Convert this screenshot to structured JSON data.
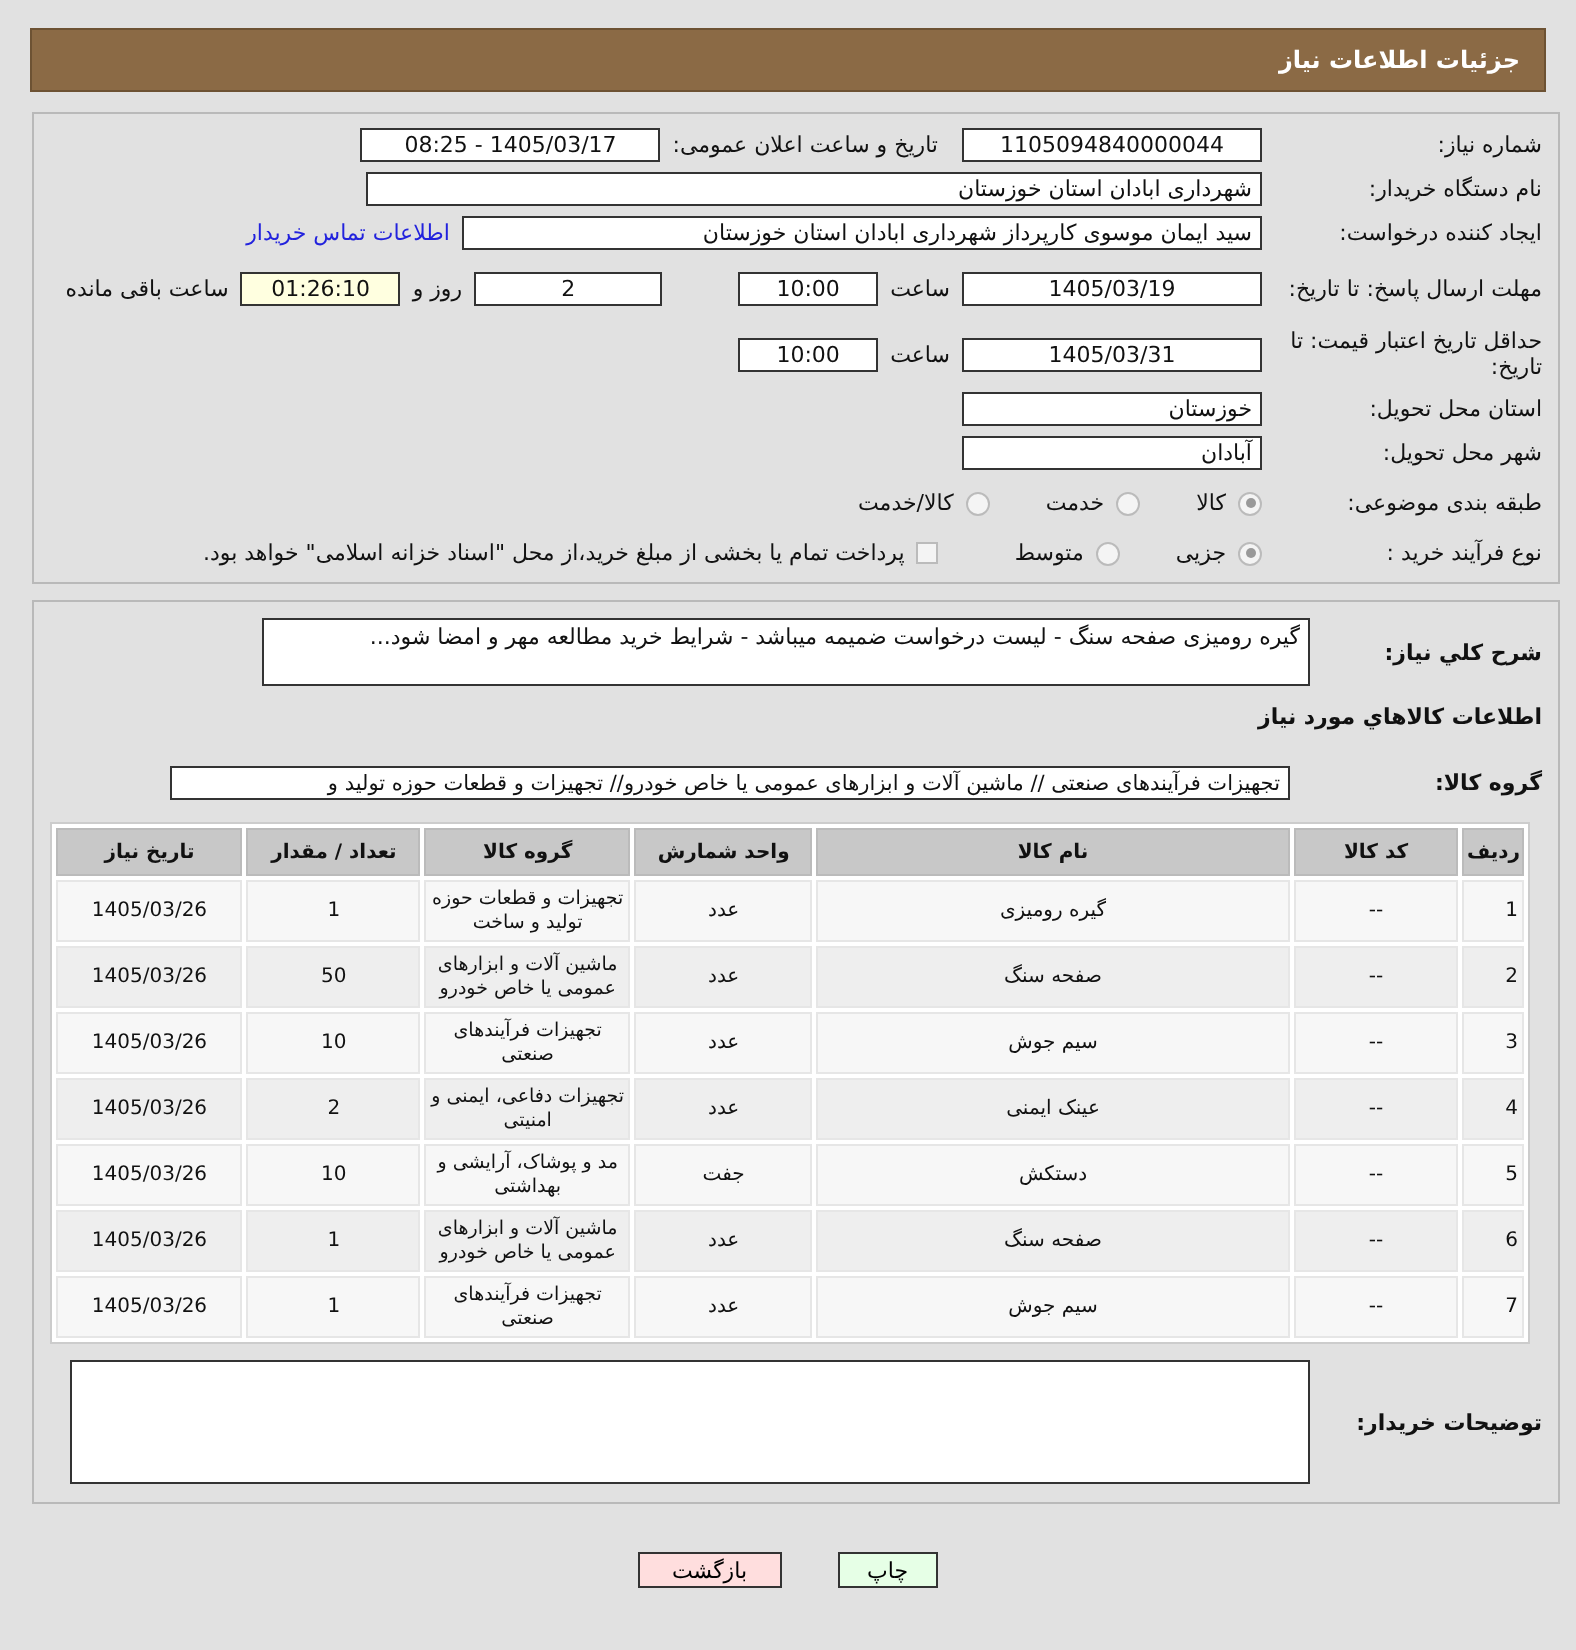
{
  "header": {
    "title": "جزئیات اطلاعات نیاز"
  },
  "details": {
    "need_number": {
      "label": "شماره نیاز:",
      "value": "1105094840000044"
    },
    "announce": {
      "label": "تاریخ و ساعت اعلان عمومی:",
      "value": "1405/03/17 - 08:25"
    },
    "buyer": {
      "label": "نام دستگاه خریدار:",
      "value": "شهرداری ابادان استان خوزستان"
    },
    "requester": {
      "label": "ایجاد کننده درخواست:",
      "value": "سید ایمان موسوی کارپرداز شهرداری ابادان استان خوزستان",
      "link": "اطلاعات تماس خریدار"
    },
    "reply_deadline": {
      "label": "مهلت ارسال پاسخ: تا تاریخ:",
      "date": "1405/03/19",
      "time_label": "ساعت",
      "time": "10:00",
      "days": "2",
      "days_label": "روز و",
      "remaining": "01:26:10",
      "remaining_label": "ساعت باقی مانده"
    },
    "price_validity": {
      "label": "حداقل تاریخ اعتبار قیمت: تا تاریخ:",
      "date": "1405/03/31",
      "time_label": "ساعت",
      "time": "10:00"
    },
    "province": {
      "label": "استان محل تحویل:",
      "value": "خوزستان"
    },
    "city": {
      "label": "شهر محل تحویل:",
      "value": "آبادان"
    },
    "category": {
      "label": "طبقه بندی موضوعی:",
      "options": [
        {
          "label": "کالا",
          "selected": true
        },
        {
          "label": "خدمت",
          "selected": false
        },
        {
          "label": "کالا/خدمت",
          "selected": false
        }
      ]
    },
    "process": {
      "label": "نوع فرآیند خرید :",
      "options": [
        {
          "label": "جزیی",
          "selected": true
        },
        {
          "label": "متوسط",
          "selected": false
        }
      ],
      "treasury": {
        "label": "پرداخت تمام یا بخشی از مبلغ خرید،از محل \"اسناد خزانه اسلامی\" خواهد بود.",
        "checked": false
      }
    }
  },
  "items": {
    "description": {
      "label": "شرح کلي نياز:",
      "value": "گیره رومیزی صفحه سنگ - لیست درخواست ضمیمه میباشد - شرایط خرید مطالعه مهر و امضا شود..."
    },
    "section_title": "اطلاعات کالاهاي مورد نياز",
    "group": {
      "label": "گروه کالا:",
      "value": "تجهیزات فرآیندهای صنعتی //  ماشین آلات و ابزارهای عمومی یا خاص خودرو// تجهیزات و قطعات حوزه تولید و"
    },
    "table": {
      "columns": [
        "ردیف",
        "کد کالا",
        "نام کالا",
        "واحد شمارش",
        "گروه کالا",
        "تعداد / مقدار",
        "تاریخ نیاز"
      ],
      "rows": [
        [
          "1",
          "--",
          "گیره رومیزی",
          "عدد",
          "تجهیزات و قطعات حوزه تولید و ساخت",
          "1",
          "1405/03/26"
        ],
        [
          "2",
          "--",
          "صفحه سنگ",
          "عدد",
          "ماشین آلات و ابزارهای عمومی یا خاص خودرو",
          "50",
          "1405/03/26"
        ],
        [
          "3",
          "--",
          "سیم جوش",
          "عدد",
          "تجهیزات فرآیندهای صنعتی",
          "10",
          "1405/03/26"
        ],
        [
          "4",
          "--",
          "عینک ایمنی",
          "عدد",
          "تجهیزات دفاعی، ایمنی و امنیتی",
          "2",
          "1405/03/26"
        ],
        [
          "5",
          "--",
          "دستکش",
          "جفت",
          "مد و پوشاک، آرایشی و بهداشتی",
          "10",
          "1405/03/26"
        ],
        [
          "6",
          "--",
          "صفحه سنگ",
          "عدد",
          "ماشین آلات و ابزارهای عمومی یا خاص خودرو",
          "1",
          "1405/03/26"
        ],
        [
          "7",
          "--",
          "سیم جوش",
          "عدد",
          "تجهیزات فرآیندهای صنعتی",
          "1",
          "1405/03/26"
        ]
      ]
    }
  },
  "buyer_notes": {
    "label": "توضیحات خریدار:"
  },
  "buttons": [
    {
      "label": "چاپ",
      "kind": "print"
    },
    {
      "label": "بازگشت",
      "kind": "back"
    }
  ]
}
